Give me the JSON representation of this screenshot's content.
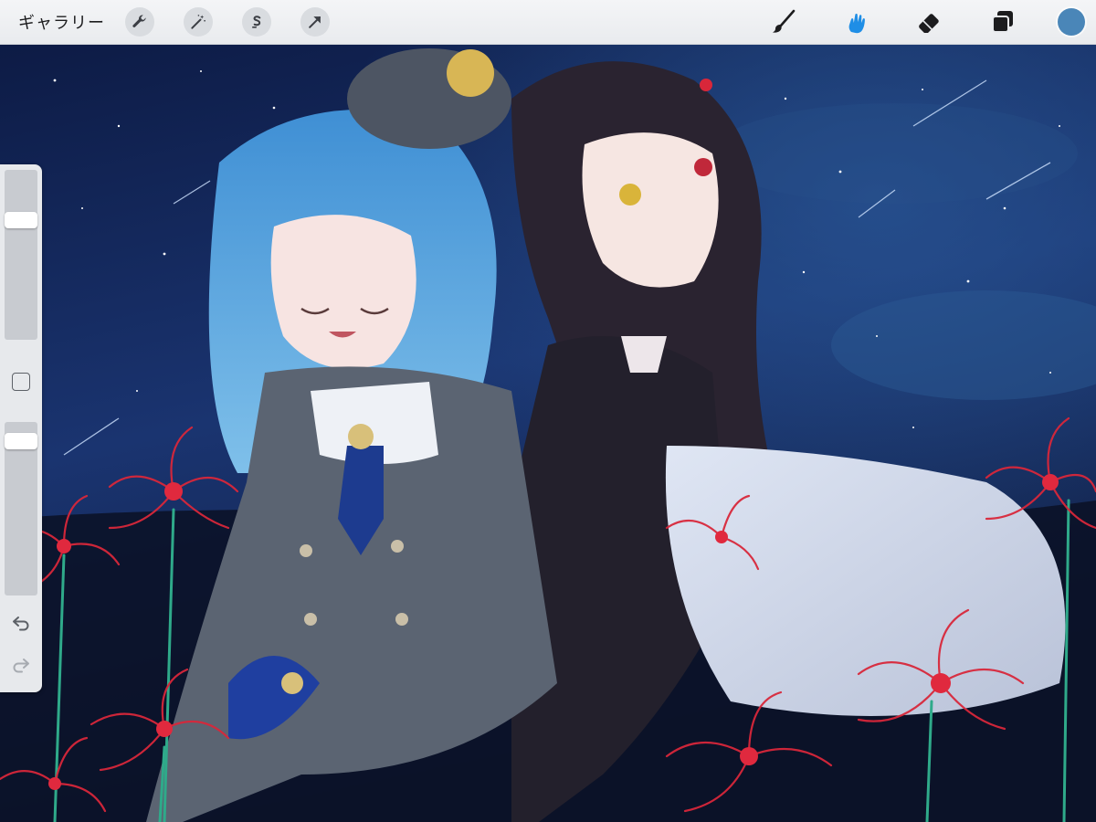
{
  "toolbar": {
    "gallery_label": "ギャラリー",
    "left_tools": [
      "wrench-icon",
      "magic-wand-icon",
      "selection-s-icon",
      "transform-arrow-icon"
    ],
    "right_tools": [
      "brush-icon",
      "smudge-icon",
      "eraser-icon",
      "layers-icon"
    ],
    "active_tool": "smudge-icon",
    "current_color": "#4a86b8"
  },
  "sidebar": {
    "brush_size_level": 0.13,
    "opacity_level": 0.06,
    "buttons": [
      "modify-square",
      "undo-icon",
      "redo-icon"
    ]
  },
  "canvas": {
    "artwork": "illustration",
    "colors": {
      "sky": "#15265a",
      "accent_flower": "#d8273a",
      "hair_blue": "#58a7e0",
      "hair_dark": "#2a2330"
    }
  }
}
